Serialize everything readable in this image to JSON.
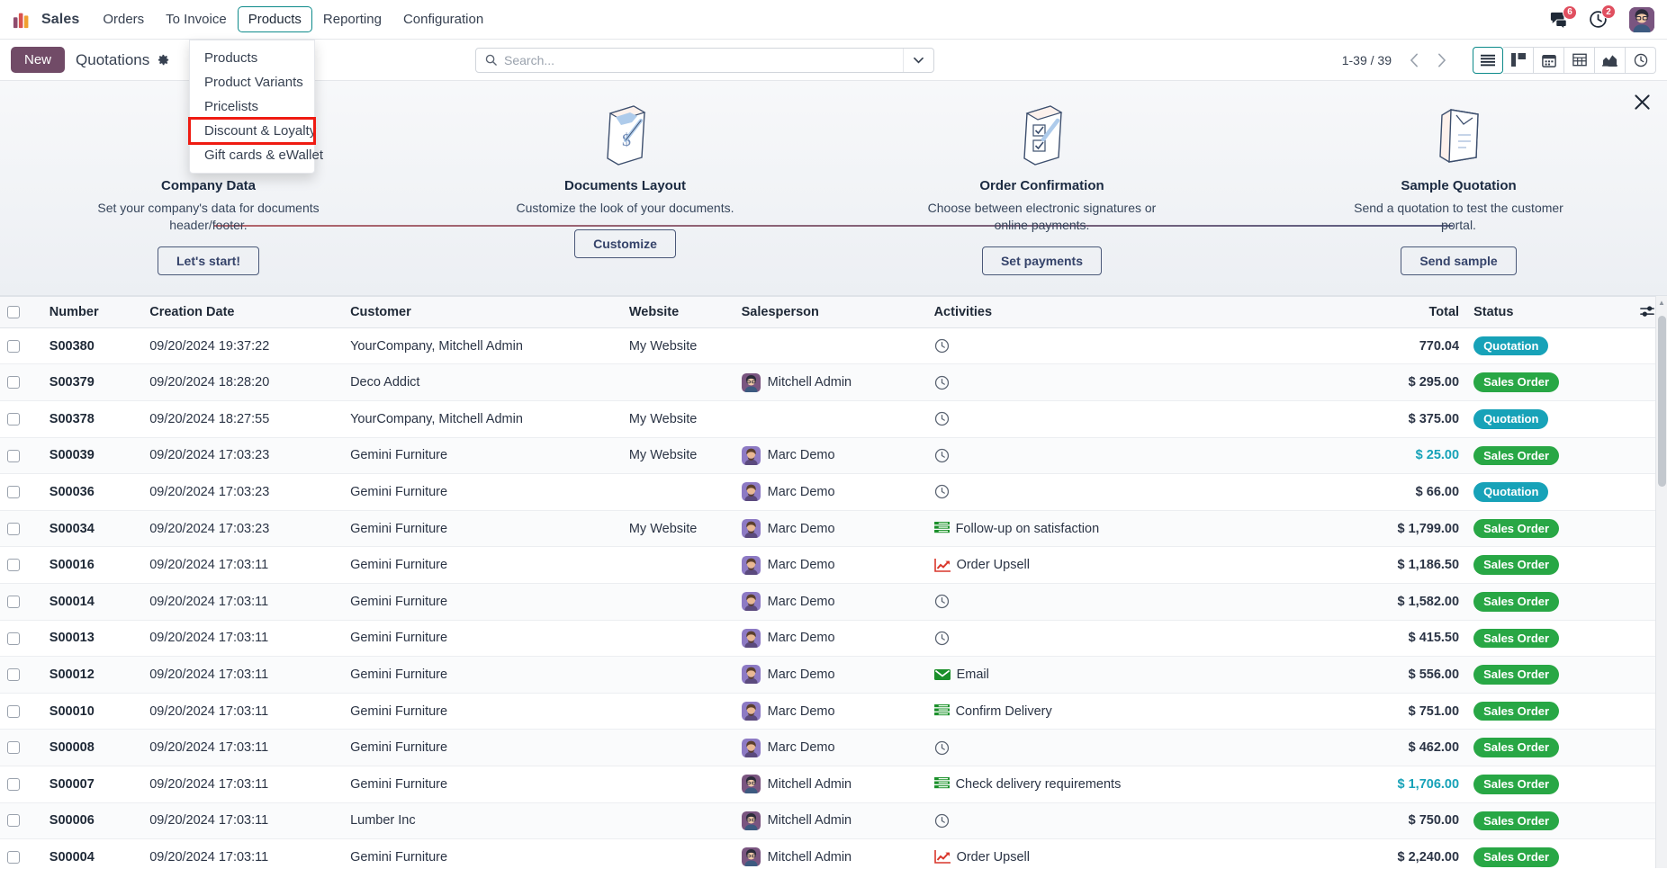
{
  "app": {
    "brand": "Sales",
    "menus": [
      "Orders",
      "To Invoice",
      "Products",
      "Reporting",
      "Configuration"
    ],
    "active_menu": "Products"
  },
  "dropdown": {
    "items": [
      "Products",
      "Product Variants",
      "Pricelists",
      "Discount & Loyalty",
      "Gift cards & eWallet"
    ],
    "highlighted": "Discount & Loyalty",
    "highlight_color": "#ef1b12"
  },
  "systray": {
    "messages_icon": "messages-icon",
    "messages_count": "6",
    "activities_icon": "clock-icon",
    "activities_count": "2",
    "avatar": "user-avatar"
  },
  "control_panel": {
    "new_label": "New",
    "title": "Quotations",
    "gear_icon": "gear-icon",
    "search_placeholder": "Search...",
    "search_value": "",
    "search_icon": "search-icon",
    "search_caret_icon": "caret-down-icon",
    "pager": "1-39 / 39",
    "prev_icon": "chevron-left-icon",
    "next_icon": "chevron-right-icon",
    "views": [
      {
        "name": "list-view",
        "icon": "list-icon",
        "active": true
      },
      {
        "name": "kanban-view",
        "icon": "kanban-icon",
        "active": false
      },
      {
        "name": "calendar-view",
        "icon": "calendar-icon",
        "active": false
      },
      {
        "name": "pivot-view",
        "icon": "pivot-icon",
        "active": false
      },
      {
        "name": "graph-view",
        "icon": "graph-icon",
        "active": false
      },
      {
        "name": "activity-view",
        "icon": "clock-icon",
        "active": false
      }
    ]
  },
  "onboarding": {
    "close_icon": "close-icon",
    "steps": [
      {
        "title": "Company Data",
        "desc": "Set your company's data for documents header/footer.",
        "button": "Let's start!",
        "art": "document-dollar-icon"
      },
      {
        "title": "Documents Layout",
        "desc": "Customize the look of your documents.",
        "button": "Customize",
        "art": "document-pen-icon"
      },
      {
        "title": "Order Confirmation",
        "desc": "Choose between electronic signatures or online payments.",
        "button": "Set payments",
        "art": "checklist-pen-icon"
      },
      {
        "title": "Sample Quotation",
        "desc": "Send a quotation to test the customer portal.",
        "button": "Send sample",
        "art": "envelope-document-icon"
      }
    ]
  },
  "list": {
    "columns": [
      "Number",
      "Creation Date",
      "Customer",
      "Website",
      "Salesperson",
      "Activities",
      "Total",
      "Status"
    ],
    "options_icon": "list-options-icon",
    "rows": [
      {
        "number": "S00380",
        "date": "09/20/2024 19:37:22",
        "customer": "YourCompany, Mitchell Admin",
        "website": "My Website",
        "salesperson": "",
        "activity": "",
        "activity_icon": "clock-icon",
        "total": "770.04",
        "total_accent": false,
        "status": "Quotation",
        "status_type": "quotation"
      },
      {
        "number": "S00379",
        "date": "09/20/2024 18:28:20",
        "customer": "Deco Addict",
        "website": "",
        "salesperson": "Mitchell Admin",
        "activity": "",
        "activity_icon": "clock-icon",
        "total": "$ 295.00",
        "total_accent": false,
        "status": "Sales Order",
        "status_type": "sales"
      },
      {
        "number": "S00378",
        "date": "09/20/2024 18:27:55",
        "customer": "YourCompany, Mitchell Admin",
        "website": "My Website",
        "salesperson": "",
        "activity": "",
        "activity_icon": "clock-icon",
        "total": "$ 375.00",
        "total_accent": false,
        "status": "Quotation",
        "status_type": "quotation"
      },
      {
        "number": "S00039",
        "date": "09/20/2024 17:03:23",
        "customer": "Gemini Furniture",
        "website": "My Website",
        "salesperson": "Marc Demo",
        "activity": "",
        "activity_icon": "clock-icon",
        "total": "$ 25.00",
        "total_accent": true,
        "status": "Sales Order",
        "status_type": "sales"
      },
      {
        "number": "S00036",
        "date": "09/20/2024 17:03:23",
        "customer": "Gemini Furniture",
        "website": "",
        "salesperson": "Marc Demo",
        "activity": "",
        "activity_icon": "clock-icon",
        "total": "$ 66.00",
        "total_accent": false,
        "status": "Quotation",
        "status_type": "quotation"
      },
      {
        "number": "S00034",
        "date": "09/20/2024 17:03:23",
        "customer": "Gemini Furniture",
        "website": "My Website",
        "salesperson": "Marc Demo",
        "activity": "Follow-up on satisfaction",
        "activity_icon": "list-green-icon",
        "total": "$ 1,799.00",
        "total_accent": false,
        "status": "Sales Order",
        "status_type": "sales"
      },
      {
        "number": "S00016",
        "date": "09/20/2024 17:03:11",
        "customer": "Gemini Furniture",
        "website": "",
        "salesperson": "Marc Demo",
        "activity": "Order Upsell",
        "activity_icon": "upsell-chart-icon",
        "total": "$ 1,186.50",
        "total_accent": false,
        "status": "Sales Order",
        "status_type": "sales"
      },
      {
        "number": "S00014",
        "date": "09/20/2024 17:03:11",
        "customer": "Gemini Furniture",
        "website": "",
        "salesperson": "Marc Demo",
        "activity": "",
        "activity_icon": "clock-icon",
        "total": "$ 1,582.00",
        "total_accent": false,
        "status": "Sales Order",
        "status_type": "sales"
      },
      {
        "number": "S00013",
        "date": "09/20/2024 17:03:11",
        "customer": "Gemini Furniture",
        "website": "",
        "salesperson": "Marc Demo",
        "activity": "",
        "activity_icon": "clock-icon",
        "total": "$ 415.50",
        "total_accent": false,
        "status": "Sales Order",
        "status_type": "sales"
      },
      {
        "number": "S00012",
        "date": "09/20/2024 17:03:11",
        "customer": "Gemini Furniture",
        "website": "",
        "salesperson": "Marc Demo",
        "activity": "Email",
        "activity_icon": "envelope-green-icon",
        "total": "$ 556.00",
        "total_accent": false,
        "status": "Sales Order",
        "status_type": "sales"
      },
      {
        "number": "S00010",
        "date": "09/20/2024 17:03:11",
        "customer": "Gemini Furniture",
        "website": "",
        "salesperson": "Marc Demo",
        "activity": "Confirm Delivery",
        "activity_icon": "list-green-icon",
        "total": "$ 751.00",
        "total_accent": false,
        "status": "Sales Order",
        "status_type": "sales"
      },
      {
        "number": "S00008",
        "date": "09/20/2024 17:03:11",
        "customer": "Gemini Furniture",
        "website": "",
        "salesperson": "Marc Demo",
        "activity": "",
        "activity_icon": "clock-icon",
        "total": "$ 462.00",
        "total_accent": false,
        "status": "Sales Order",
        "status_type": "sales"
      },
      {
        "number": "S00007",
        "date": "09/20/2024 17:03:11",
        "customer": "Gemini Furniture",
        "website": "",
        "salesperson": "Mitchell Admin",
        "activity": "Check delivery requirements",
        "activity_icon": "list-green-icon",
        "total": "$ 1,706.00",
        "total_accent": true,
        "status": "Sales Order",
        "status_type": "sales"
      },
      {
        "number": "S00006",
        "date": "09/20/2024 17:03:11",
        "customer": "Lumber Inc",
        "website": "",
        "salesperson": "Mitchell Admin",
        "activity": "",
        "activity_icon": "clock-icon",
        "total": "$ 750.00",
        "total_accent": false,
        "status": "Sales Order",
        "status_type": "sales"
      },
      {
        "number": "S00004",
        "date": "09/20/2024 17:03:11",
        "customer": "Gemini Furniture",
        "website": "",
        "salesperson": "Mitchell Admin",
        "activity": "Order Upsell",
        "activity_icon": "upsell-chart-icon",
        "total": "$ 2,240.00",
        "total_accent": false,
        "status": "Sales Order",
        "status_type": "sales"
      }
    ]
  },
  "colors": {
    "brand_purple": "#714b67",
    "accent_teal": "#17a2b8",
    "success_green": "#28a745",
    "badge_red": "#e04f5f",
    "highlight_red": "#ef1b12"
  }
}
